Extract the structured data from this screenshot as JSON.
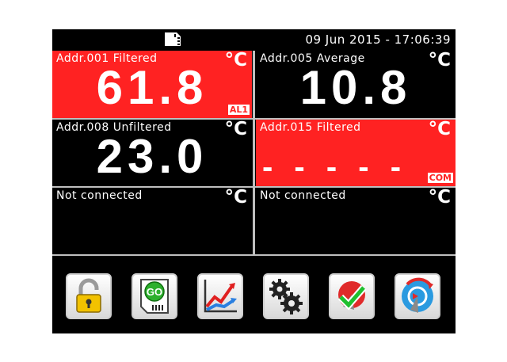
{
  "status": {
    "datetime": "09 Jun 2015 - 17:06:39",
    "sd_icon": "sd-card-icon"
  },
  "channels": [
    {
      "label": "Addr.001 Filtered",
      "unit": "°C",
      "value": "61.8",
      "flag": "AL1",
      "state": "alarm"
    },
    {
      "label": "Addr.005 Average",
      "unit": "°C",
      "value": "10.8",
      "flag": "",
      "state": "normal"
    },
    {
      "label": "Addr.008 Unfiltered",
      "unit": "°C",
      "value": "23.0",
      "flag": "",
      "state": "normal"
    },
    {
      "label": "Addr.015 Filtered",
      "unit": "°C",
      "value": "- - - - -",
      "flag": "COM",
      "state": "alarm"
    },
    {
      "label": "Not connected",
      "unit": "°C",
      "value": "",
      "flag": "",
      "state": "normal"
    },
    {
      "label": "Not connected",
      "unit": "°C",
      "value": "",
      "flag": "",
      "state": "normal"
    }
  ],
  "toolbar": [
    {
      "icon": "lock-icon"
    },
    {
      "icon": "go-sd-card-icon",
      "text": "GO"
    },
    {
      "icon": "trend-chart-icon"
    },
    {
      "icon": "gears-icon"
    },
    {
      "icon": "alarm-ack-icon"
    },
    {
      "icon": "reset-icon"
    }
  ],
  "colors": {
    "alarm_bg": "#ff2222",
    "screen_bg": "#000000",
    "text": "#ffffff"
  }
}
